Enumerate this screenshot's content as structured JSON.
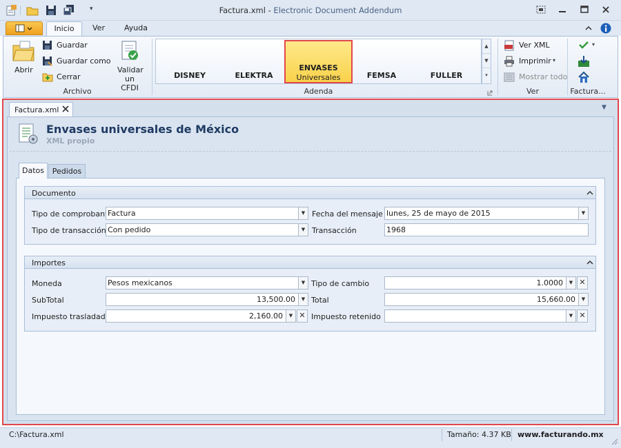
{
  "window": {
    "title_file": "Factura.xml",
    "title_sep": " - ",
    "title_app": "Electronic Document Addendum"
  },
  "ribbon_tabs": [
    "Inicio",
    "Ver",
    "Ayuda"
  ],
  "archivo": {
    "abrir": "Abrir",
    "guardar": "Guardar",
    "guardar_como": "Guardar como",
    "cerrar": "Cerrar",
    "validar_line1": "Validar",
    "validar_line2": "un CFDI",
    "group_label": "Archivo"
  },
  "adenda": {
    "items": [
      "DISNEY",
      "ELEKTRA",
      "FEMSA",
      "FULLER"
    ],
    "selected_line1": "ENVASES",
    "selected_line2": "Universales",
    "group_label": "Adenda"
  },
  "ver": {
    "ver_xml": "Ver XML",
    "imprimir": "Imprimir",
    "mostrar_todo": "Mostrar todo",
    "group_label": "Ver"
  },
  "factura_group": {
    "group_label": "Factura..."
  },
  "doc": {
    "tab_label": "Factura.xml",
    "title": "Envases universales de México",
    "subtitle": "XML propio"
  },
  "panel_tabs": [
    "Datos",
    "Pedidos"
  ],
  "documento": {
    "header": "Documento",
    "tipo_comprobante_label": "Tipo de comprobante",
    "tipo_comprobante_value": "Factura",
    "fecha_mensaje_label": "Fecha del mensaje",
    "fecha_mensaje_value": "lunes, 25 de mayo de 2015",
    "tipo_transaccion_label": "Tipo de transacción",
    "tipo_transaccion_value": "Con pedido",
    "transaccion_label": "Transacción",
    "transaccion_value": "1968"
  },
  "importes": {
    "header": "Importes",
    "moneda_label": "Moneda",
    "moneda_value": "Pesos mexicanos",
    "tipo_cambio_label": "Tipo de cambio",
    "tipo_cambio_value": "1.0000",
    "subtotal_label": "SubTotal",
    "subtotal_value": "13,500.00",
    "total_label": "Total",
    "total_value": "15,660.00",
    "imp_trasladado_label": "Impuesto trasladado",
    "imp_trasladado_value": "2,160.00",
    "imp_retenido_label": "Impuesto retenido",
    "imp_retenido_value": ""
  },
  "status": {
    "path": "C:\\Factura.xml",
    "size": "Tamaño: 4.37 KB",
    "website": "www.facturando.mx"
  },
  "colors": {
    "accent_orange": "#f0a020",
    "highlight_red": "#e0474c",
    "title_blue": "#1f3b63"
  }
}
